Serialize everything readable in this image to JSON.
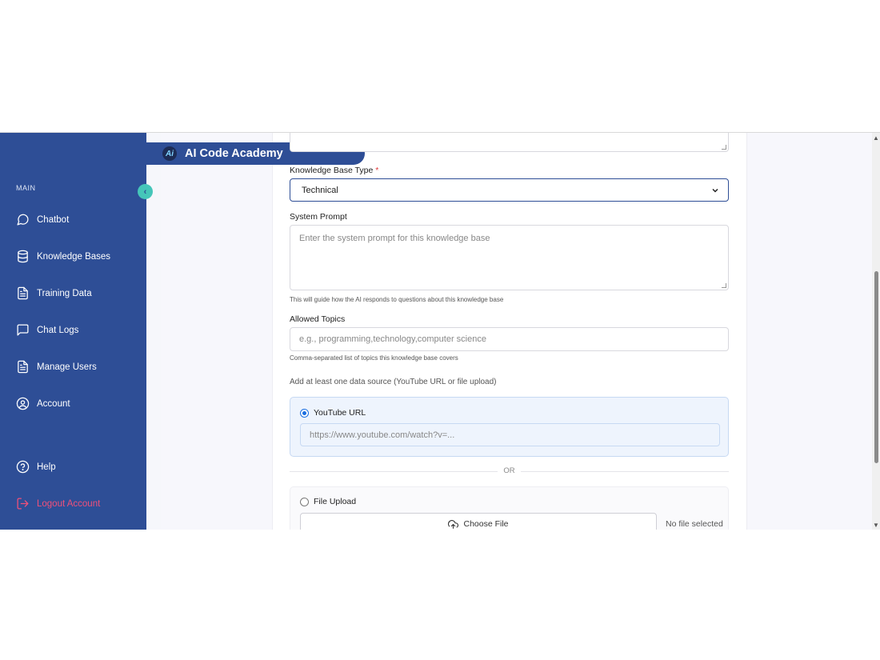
{
  "app": {
    "brand_name": "AI Code Academy",
    "brand_logo_text": "Ai"
  },
  "sidebar": {
    "section_label": "MAIN",
    "items": [
      {
        "label": "Chatbot",
        "icon": "chat-bubble-icon"
      },
      {
        "label": "Knowledge Bases",
        "icon": "database-icon"
      },
      {
        "label": "Training Data",
        "icon": "document-icon"
      },
      {
        "label": "Chat Logs",
        "icon": "message-square-icon"
      },
      {
        "label": "Manage Users",
        "icon": "document-icon"
      },
      {
        "label": "Account",
        "icon": "user-circle-icon"
      }
    ],
    "help_label": "Help",
    "logout_label": "Logout Account",
    "collapse_glyph": "‹"
  },
  "form": {
    "kb_type_label": "Knowledge Base Type",
    "required_mark": "*",
    "kb_type_value": "Technical",
    "system_prompt_label": "System Prompt",
    "system_prompt_placeholder": "Enter the system prompt for this knowledge base",
    "system_prompt_help": "This will guide how the AI responds to questions about this knowledge base",
    "topics_label": "Allowed Topics",
    "topics_placeholder": "e.g., programming,technology,computer science",
    "topics_help": "Comma-separated list of topics this knowledge base covers",
    "source_note": "Add at least one data source (YouTube URL or file upload)",
    "youtube_label": "YouTube URL",
    "youtube_placeholder": "https://www.youtube.com/watch?v=...",
    "or_text": "OR",
    "file_upload_label": "File Upload",
    "choose_file_label": "Choose File",
    "no_file_text": "No file selected"
  },
  "colors": {
    "sidebar": "#2e4e96",
    "accent": "#45c6b9",
    "logout": "#f0507a",
    "radio_selected": "#1a6ee0"
  }
}
